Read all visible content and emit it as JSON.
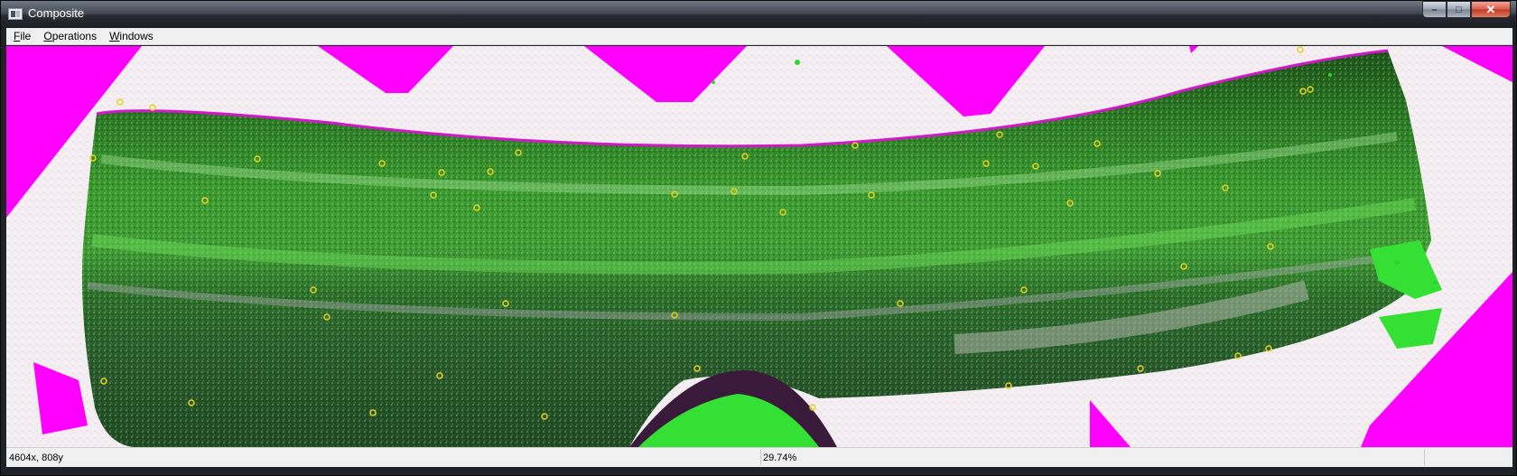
{
  "window": {
    "title": "Composite"
  },
  "window_controls": {
    "minimize": "–",
    "maximize": "□",
    "close": "✕"
  },
  "menu": {
    "items": [
      {
        "mnemonic": "F",
        "rest": "ile"
      },
      {
        "mnemonic": "O",
        "rest": "perations"
      },
      {
        "mnemonic": "W",
        "rest": "indows"
      }
    ]
  },
  "status": {
    "coordinates": "4604x, 808y",
    "zoom": "29.74%"
  },
  "image": {
    "colors": {
      "background": "#f4eef3",
      "magenta": "#ff00ff",
      "tissue_dark": "#1f5a1c",
      "tissue_green": "#2f8f24",
      "highlight_green": "#35e035",
      "marker_yellow": "#e8d21e"
    }
  }
}
